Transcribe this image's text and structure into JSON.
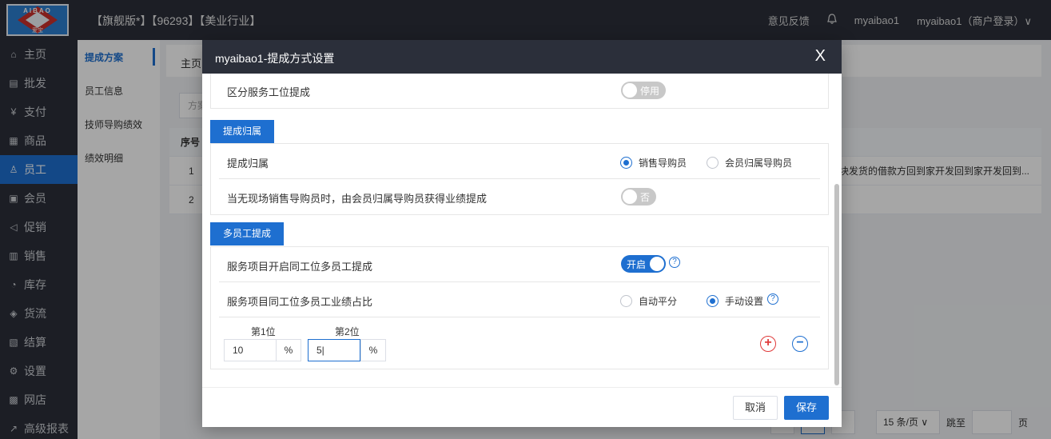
{
  "topbar": {
    "logo_text": "AIBAO",
    "logo_sub": "爱宝",
    "title": "【旗舰版*】【96293】【美业行业】",
    "feedback": "意见反馈",
    "bell_icon": "bell-icon",
    "user": "myaibao1",
    "account": "myaibao1（商户登录）∨"
  },
  "sidebar": {
    "items": [
      {
        "label": "主页",
        "icon": "⌂"
      },
      {
        "label": "批发",
        "icon": "▤"
      },
      {
        "label": "支付",
        "icon": "¥"
      },
      {
        "label": "商品",
        "icon": "▦"
      },
      {
        "label": "员工",
        "icon": "♙"
      },
      {
        "label": "会员",
        "icon": "▣"
      },
      {
        "label": "促销",
        "icon": "◁"
      },
      {
        "label": "销售",
        "icon": "▥"
      },
      {
        "label": "库存",
        "icon": "◔"
      },
      {
        "label": "货流",
        "icon": "◈"
      },
      {
        "label": "结算",
        "icon": "▧"
      },
      {
        "label": "设置",
        "icon": "⚙"
      },
      {
        "label": "网店",
        "icon": "▩"
      },
      {
        "label": "高级报表",
        "icon": "↗"
      }
    ]
  },
  "submenu": {
    "items": [
      "提成方案",
      "员工信息",
      "技师导购绩效",
      "绩效明细"
    ]
  },
  "background": {
    "crumb": "主页",
    "filter_placeholder": "方案",
    "table_head_seq": "序号",
    "rows": [
      "1",
      "2"
    ],
    "row1_long": "块发货的借款方回到家开发回到家开发回到...",
    "page_size": "15 条/页 ∨",
    "jump_label": "跳至",
    "page_unit": "页"
  },
  "modal": {
    "title": "myaibao1-提成方式设置",
    "close_label": "X",
    "row_service_position": "区分服务工位提成",
    "switch_off_label": "停用",
    "section_attribution": "提成归属",
    "row_attribution": "提成归属",
    "radio_sales_guide": "销售导购员",
    "radio_member_guide": "会员归属导购员",
    "row_no_sales_guide": "当无现场销售导购员时，由会员归属导购员获得业绩提成",
    "switch_no_label": "否",
    "section_multi": "多员工提成",
    "row_multi_enable": "服务项目开启同工位多员工提成",
    "switch_on_label": "开启",
    "row_ratio": "服务项目同工位多员工业绩占比",
    "radio_auto": "自动平分",
    "radio_manual": "手动设置",
    "pos1_label": "第1位",
    "pos2_label": "第2位",
    "pos1_value": "10",
    "pos2_value": "5|",
    "unit": "%",
    "add_symbol": "+",
    "remove_symbol": "−",
    "cancel": "取消",
    "save": "保存"
  }
}
